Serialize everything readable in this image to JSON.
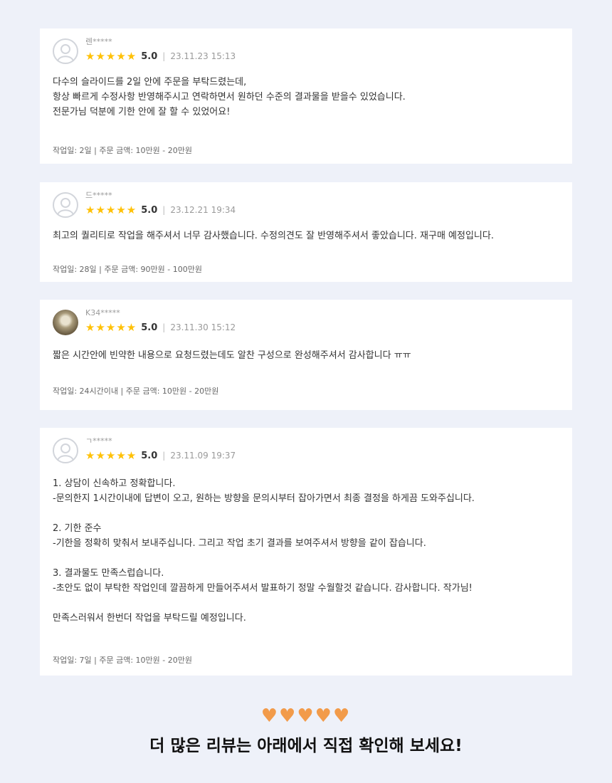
{
  "reviews": [
    {
      "reviewer": "렌*****",
      "stars": "★★★★★",
      "score": "5.0",
      "separator": "|",
      "date": "23.11.23 15:13",
      "body": "다수의 슬라이드를 2일 안에 주문을 부탁드렸는데,\n항상 빠르게 수정사항 반영해주시고 연락하면서 원하던 수준의 결과물을 받을수 있었습니다.\n전문가님 덕분에 기한 안에 잘 할 수 있었어요!",
      "meta": "작업일: 2일 | 주문 금액: 10만원 - 20만원",
      "avatar": "default-user-icon"
    },
    {
      "reviewer": "드*****",
      "stars": "★★★★★",
      "score": "5.0",
      "separator": "|",
      "date": "23.12.21 19:34",
      "body": "최고의 퀄리티로 작업을 해주셔서 너무 감사했습니다. 수정의견도 잘 반영해주셔서 좋았습니다. 재구매 예정입니다.",
      "meta": "작업일: 28일 | 주문 금액: 90만원 - 100만원",
      "avatar": "default-user-icon"
    },
    {
      "reviewer": "K34*****",
      "stars": "★★★★★",
      "score": "5.0",
      "separator": "|",
      "date": "23.11.30 15:12",
      "body": "짧은 시간안에 빈약한 내용으로 요청드렸는데도 알찬 구성으로 완성해주셔서 감사합니다 ㅠㅠ",
      "meta": "작업일: 24시간이내 | 주문 금액: 10만원 - 20만원",
      "avatar": "photo"
    },
    {
      "reviewer": "ㄱ*****",
      "stars": "★★★★★",
      "score": "5.0",
      "separator": "|",
      "date": "23.11.09 19:37",
      "body": "1. 상담이 신속하고 정확합니다.\n-문의한지 1시간이내에 답변이 오고, 원하는 방향을 문의시부터 잡아가면서 최종 결정을 하게끔 도와주십니다.\n\n2. 기한 준수\n-기한을 정확히 맞춰서 보내주십니다. 그리고 작업 초기 결과를 보여주셔서 방향을 같이 잡습니다.\n\n3. 결과물도 만족스럽습니다.\n-초안도 없이 부탁한 작업인데 깔끔하게 만들어주셔서 발표하기 정말 수월할것 같습니다. 감사합니다. 작가님!\n\n만족스러워서 한번더 작업을 부탁드릴 예정입니다.",
      "meta": "작업일: 7일 | 주문 금액: 10만원 - 20만원",
      "avatar": "default-user-icon"
    }
  ],
  "footer": {
    "hearts": "♥♥♥♥♥",
    "heart_color": "#f29b4a",
    "text": "더 많은 리뷰는 아래에서 직접 확인해 보세요!"
  },
  "colors": {
    "background": "#eef1f9",
    "star": "#ffc107",
    "card": "#ffffff"
  }
}
